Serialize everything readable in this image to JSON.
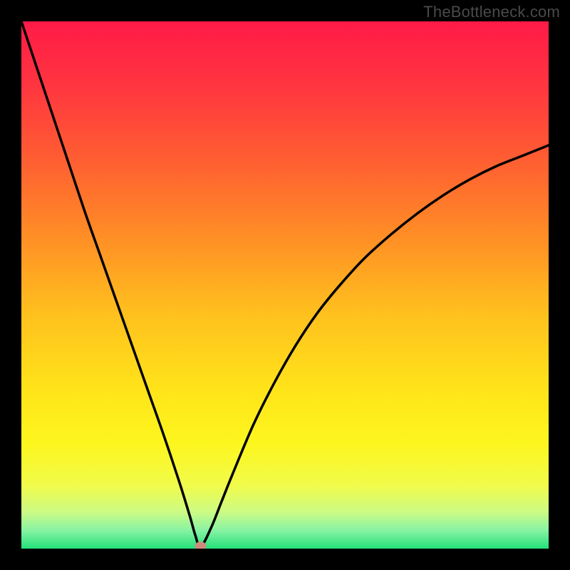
{
  "watermark": "TheBottleneck.com",
  "chart_data": {
    "type": "line",
    "title": "",
    "xlabel": "",
    "ylabel": "",
    "xlim": [
      0,
      100
    ],
    "ylim": [
      0,
      100
    ],
    "optimal_x": 34,
    "marker_color": "#cf8a7e",
    "curve_color": "#000000",
    "gradient_stops": [
      {
        "offset": 0.0,
        "color": "#ff1a47"
      },
      {
        "offset": 0.12,
        "color": "#ff3540"
      },
      {
        "offset": 0.25,
        "color": "#ff5a33"
      },
      {
        "offset": 0.4,
        "color": "#ff8b26"
      },
      {
        "offset": 0.55,
        "color": "#ffbf1e"
      },
      {
        "offset": 0.7,
        "color": "#ffe41a"
      },
      {
        "offset": 0.8,
        "color": "#fdf61e"
      },
      {
        "offset": 0.88,
        "color": "#f1fb4a"
      },
      {
        "offset": 0.93,
        "color": "#cdfb84"
      },
      {
        "offset": 0.965,
        "color": "#88f3a3"
      },
      {
        "offset": 1.0,
        "color": "#24e07a"
      }
    ],
    "left_branch": {
      "x": [
        0,
        3,
        6,
        9,
        12,
        15,
        18,
        21,
        24,
        27,
        30,
        32,
        33,
        34
      ],
      "values": [
        100,
        91,
        82,
        73,
        64,
        55.5,
        47,
        38.5,
        30,
        21.5,
        12.5,
        6,
        2.5,
        0.3
      ]
    },
    "right_branch": {
      "x": [
        34,
        36,
        38,
        40,
        44,
        48,
        52,
        56,
        60,
        65,
        70,
        75,
        80,
        85,
        90,
        95,
        100
      ],
      "values": [
        0.3,
        4,
        9,
        14,
        23.5,
        31.5,
        38.5,
        44.5,
        49.5,
        55,
        59.5,
        63.5,
        67,
        70,
        72.5,
        74.5,
        76.5
      ]
    }
  }
}
